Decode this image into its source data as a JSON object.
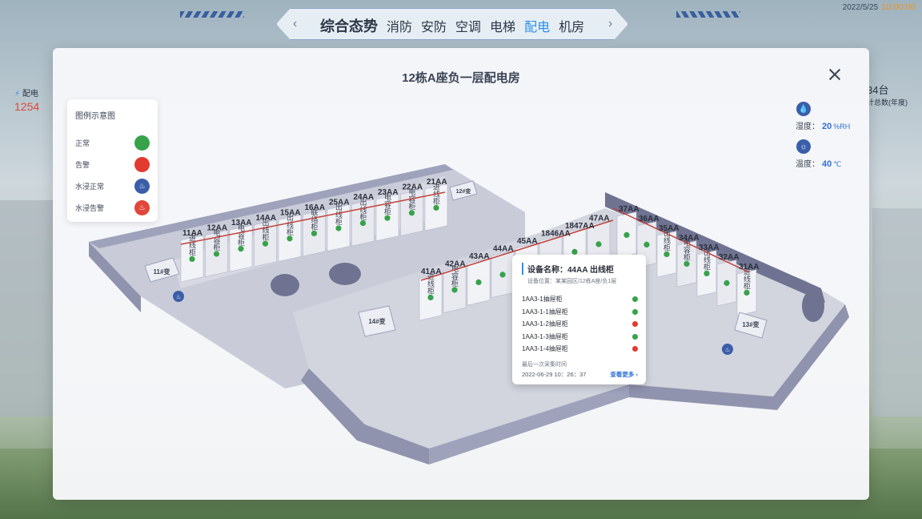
{
  "nav": {
    "tabs": [
      "综合态势",
      "消防",
      "安防",
      "空调",
      "电梯",
      "配电",
      "机房"
    ],
    "active": "配电"
  },
  "datetime": {
    "date": "2022/5/25",
    "time": "10:00:00"
  },
  "side_stat": {
    "label": "配电",
    "value": "1254"
  },
  "side_stat_right": {
    "value": "34台",
    "label": "计总数(年度)"
  },
  "modal": {
    "title": "12栋A座负一层配电房",
    "legend": {
      "title": "图例示意图",
      "items": [
        {
          "label": "正常",
          "color": "#37a24a"
        },
        {
          "label": "告警",
          "color": "#e23a2f"
        },
        {
          "label": "水浸正常",
          "color": "#3b5ea8"
        },
        {
          "label": "水浸告警",
          "color": "#e0473a"
        }
      ]
    },
    "env": {
      "humidity": {
        "label": "湿度：",
        "value": "20",
        "unit": "%RH"
      },
      "temperature": {
        "label": "温度：",
        "value": "40",
        "unit": "℃"
      }
    },
    "floor": {
      "left_wing_labels": [
        "11AA",
        "12AA",
        "13AA",
        "14AA",
        "15AA",
        "16AA",
        "25AA",
        "24AA",
        "23AA",
        "22AA",
        "21AA"
      ],
      "middle_labels": [
        "41AA",
        "42AA",
        "43AA",
        "44AA",
        "45AA",
        "1846AA",
        "1847AA",
        "47AA"
      ],
      "right_labels": [
        "37AA",
        "36AA",
        "35AA",
        "34AA",
        "33AA",
        "32AA",
        "31AA"
      ],
      "cabinet_types": [
        "进线柜",
        "电容柜",
        "电容柜",
        "出线柜",
        "出线柜",
        "联络柜",
        "出线柜",
        "出线柜",
        "电容柜",
        "电容柜",
        "进线柜"
      ],
      "transformers": [
        "11#变",
        "12#变",
        "13#变",
        "14#变"
      ]
    },
    "popup": {
      "title": "设备名称：44AA 出线柜",
      "location": "设备位置：某某园区/12栋A座/负1层",
      "rows": [
        {
          "name": "1AA3-1抽屉柜",
          "status": "normal"
        },
        {
          "name": "1AA3-1-1抽屉柜",
          "status": "normal"
        },
        {
          "name": "1AA3-1-2抽屉柜",
          "status": "alarm"
        },
        {
          "name": "1AA3-1-3抽屉柜",
          "status": "normal"
        },
        {
          "name": "1AA3-1-4抽屉柜",
          "status": "alarm"
        }
      ],
      "foot_label": "最后一次采集时间",
      "timestamp": "2022-06-29 10：26：37",
      "more_label": "查看更多 ›",
      "colors": {
        "normal": "#37a24a",
        "alarm": "#e23a2f"
      }
    }
  }
}
